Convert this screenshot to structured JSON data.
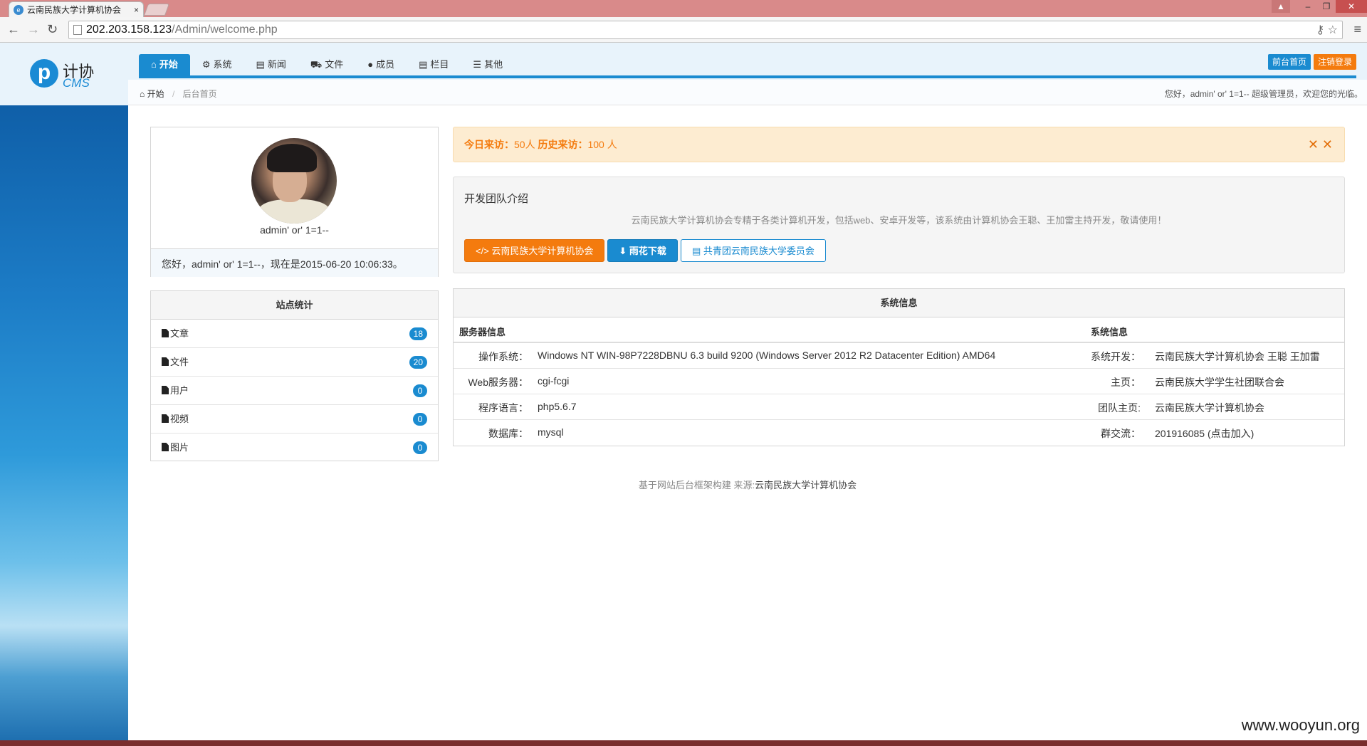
{
  "browser": {
    "tab_title": "云南民族大学计算机协会",
    "tab_close": "×",
    "favicon": "e",
    "url_host": "202.203.158.123",
    "url_path": "/Admin/welcome.php",
    "controls": {
      "user": "▲",
      "minimize": "–",
      "restore": "❐",
      "close": "✕"
    },
    "nav": {
      "back": "←",
      "forward": "→",
      "reload": "↻"
    },
    "omnibox_icons": "⚷ ☆",
    "menu": "≡"
  },
  "logo": {
    "letter": "p",
    "cn": "计协",
    "en": "CMS"
  },
  "nav": [
    {
      "icon": "⌂",
      "label": "开始",
      "active": true
    },
    {
      "icon": "⚙",
      "label": "系统"
    },
    {
      "icon": "▤",
      "label": "新闻"
    },
    {
      "icon": "⛟",
      "label": "文件"
    },
    {
      "icon": "●",
      "label": "成员"
    },
    {
      "icon": "▤",
      "label": "栏目"
    },
    {
      "icon": "☰",
      "label": "其他"
    }
  ],
  "top_buttons": {
    "front": "前台首页",
    "logout": "注销登录"
  },
  "breadcrumb": {
    "home_icon": "⌂",
    "home": "开始",
    "sep": "/",
    "current": "后台首页"
  },
  "greeting": "您好，admin' or' 1=1-- 超级管理员，欢迎您的光临。",
  "profile": {
    "name": "admin' or' 1=1--",
    "welcome": "您好，admin' or' 1=1--，现在是2015-06-20 10:06:33。"
  },
  "stats": {
    "title": "站点统计",
    "items": [
      {
        "label": "文章",
        "count": "18"
      },
      {
        "label": "文件",
        "count": "20"
      },
      {
        "label": "用户",
        "count": "0"
      },
      {
        "label": "视频",
        "count": "0"
      },
      {
        "label": "图片",
        "count": "0"
      }
    ]
  },
  "alert": {
    "today_label": "今日来访：",
    "today_value": "50人",
    "history_label": "历史来访：",
    "history_value": "100 人",
    "close": "✕ ✕"
  },
  "team": {
    "title": "开发团队介绍",
    "desc": "云南民族大学计算机协会专精于各类计算机开发，包括web、安卓开发等，该系统由计算机协会王聪、王加雷主持开发，敬请使用！",
    "btn1": "</> 云南民族大学计算机协会",
    "btn2": "⬇ 雨花下载",
    "btn3": "▤ 共青团云南民族大学委员会"
  },
  "sysinfo": {
    "title": "系统信息",
    "left_header": "服务器信息",
    "right_header": "系统信息",
    "rows": [
      {
        "k1": "操作系统：",
        "v1": "Windows NT WIN-98P7228DBNU 6.3 build 9200 (Windows Server 2012 R2 Datacenter Edition) AMD64",
        "k2": "系统开发：",
        "v2": "云南民族大学计算机协会 王聪 王加雷"
      },
      {
        "k1": "Web服务器：",
        "v1": "cgi-fcgi",
        "k2": "主页：",
        "v2": "云南民族大学学生社团联合会"
      },
      {
        "k1": "程序语言：",
        "v1": "php5.6.7",
        "k2": "团队主页:",
        "v2": "云南民族大学计算机协会"
      },
      {
        "k1": "数据库：",
        "v1": "mysql",
        "k2": "群交流：",
        "v2": "201916085 (点击加入)"
      }
    ]
  },
  "footer": {
    "prefix": "基于网站后台框架构建 来源:",
    "source": "云南民族大学计算机协会"
  },
  "watermark": "www.wooyun.org",
  "colors": {
    "primary": "#1a8bd0",
    "orange": "#f47b0e",
    "alert_bg": "#fdecd1"
  }
}
